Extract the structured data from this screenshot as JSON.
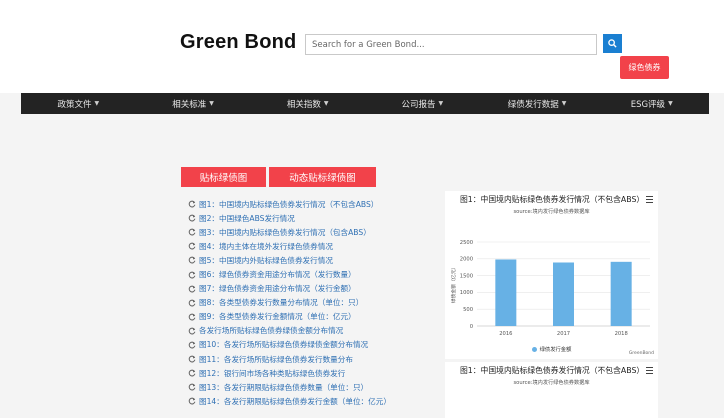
{
  "header": {
    "logo": "Green Bond",
    "search_placeholder": "Search for a Green Bond...",
    "green_bond_button": "绿色债券"
  },
  "nav": {
    "items": [
      {
        "label": "政策文件"
      },
      {
        "label": "相关标准"
      },
      {
        "label": "相关指数"
      },
      {
        "label": "公司报告"
      },
      {
        "label": "绿债发行数据"
      },
      {
        "label": "ESG评级"
      }
    ]
  },
  "buttons": {
    "labeled": "贴标绿债图",
    "dynamic": "动态贴标绿债图"
  },
  "links": [
    "图1：中国境内贴标绿色债券发行情况（不包含ABS）",
    "图2：中国绿色ABS发行情况",
    "图3：中国境内贴标绿色债券发行情况（包含ABS）",
    "图4：境内主体在境外发行绿色债券情况",
    "图5：中国境内外贴标绿色债券发行情况",
    "图6：绿色债券资金用途分布情况（发行数量）",
    "图7：绿色债券资金用途分布情况（发行金额）",
    "图8：各类型债券发行数量分布情况（单位：只）",
    "图9：各类型债券发行金额情况（单位：亿元）",
    "各发行场所贴标绿色债券绿债金额分布情况",
    "图10：各发行场所贴标绿色债券绿债金额分布情况",
    "图11：各发行场所贴标绿色债券发行数量分布",
    "图12：银行间市场各种类贴标绿色债券发行",
    "图13：各发行期限贴标绿色债券数量（单位：只）",
    "图14：各发行期限贴标绿色债券发行金额（单位：亿元）"
  ],
  "chart1": {
    "title": "图1：中国境内贴标绿色债券发行情况（不包含ABS）",
    "subtitle": "source:境内发行绿色债券数据库",
    "credit": "GreenBond"
  },
  "chart2": {
    "title": "图1：中国境内贴标绿色债券发行情况（不包含ABS）",
    "subtitle": "source:境内发行绿色债券数据库"
  },
  "chart_data": {
    "type": "bar",
    "title": "图1：中国境内贴标绿色债券发行情况（不包含ABS）",
    "subtitle": "source:境内发行绿色债券数据库",
    "categories": [
      "2016",
      "2017",
      "2018"
    ],
    "series": [
      {
        "name": "绿债发行金额",
        "values": [
          1980,
          1890,
          1910
        ]
      }
    ],
    "ylabel": "绿债金额（亿元）",
    "xlabel": "",
    "ylim": [
      0,
      2500
    ],
    "yticks": [
      0,
      500,
      1000,
      1500,
      2000,
      2500
    ],
    "grid": true,
    "legend": "bottom",
    "bar_color": "#67b1e5"
  }
}
